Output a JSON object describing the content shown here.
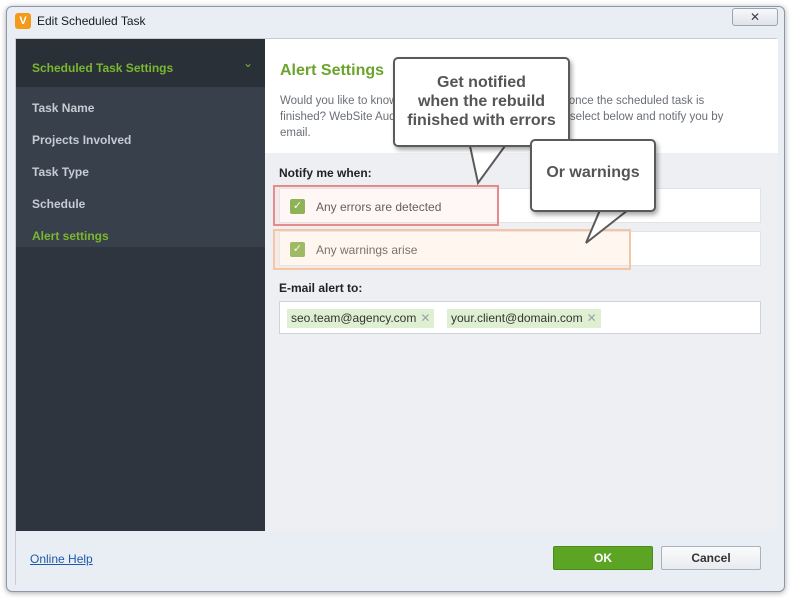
{
  "window": {
    "title": "Edit Scheduled Task",
    "app_icon": "V",
    "close_glyph": "✕"
  },
  "sidebar": {
    "header": "Scheduled Task Settings",
    "chevron": "⌄",
    "items": [
      {
        "label": "Task Name",
        "active": false
      },
      {
        "label": "Projects Involved",
        "active": false
      },
      {
        "label": "Task Type",
        "active": false
      },
      {
        "label": "Schedule",
        "active": false
      },
      {
        "label": "Alert settings",
        "active": true
      }
    ]
  },
  "main": {
    "title": "Alert Settings",
    "description_part1": "Would you like to know",
    "description_part2": "ccur once the scheduled task is",
    "description_part3": "finished? WebSite Aud",
    "description_part4": "select below and notify you by",
    "description_part5": "email.",
    "notify_label": "Notify me when:",
    "checkboxes": [
      {
        "label": "Any errors are detected",
        "checked": true
      },
      {
        "label": "Any warnings arise",
        "checked": true
      }
    ],
    "email_label": "E-mail alert to:",
    "emails": [
      "seo.team@agency.com",
      "your.client@domain.com"
    ],
    "remove_glyph": "✕"
  },
  "callouts": {
    "errors": [
      "Get notified",
      "when the rebuild",
      "finished with errors"
    ],
    "warnings": "Or warnings"
  },
  "footer": {
    "help_link": "Online Help",
    "ok": "OK",
    "cancel": "Cancel"
  },
  "colors": {
    "accent_green": "#6aa42c",
    "sidebar_bg": "#38404b",
    "ok_button": "#5ba424"
  }
}
